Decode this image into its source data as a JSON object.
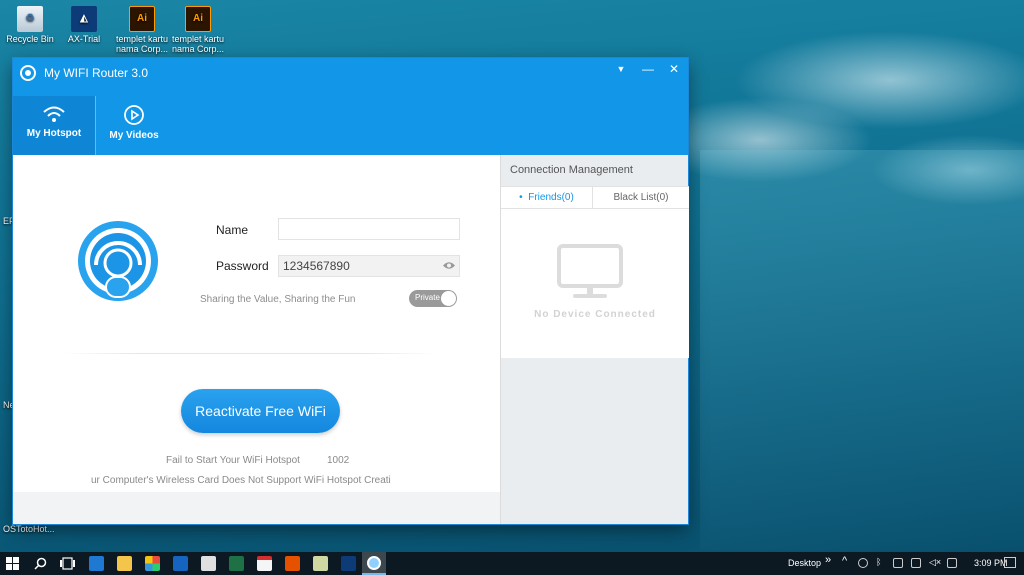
{
  "desktop": {
    "icons": [
      {
        "label": "Recycle Bin",
        "icon": "recycle-bin-icon"
      },
      {
        "label": "AX-Trial",
        "icon": "ax-trial-icon"
      },
      {
        "label": "templet kartu nama Corp...",
        "icon": "illustrator-file-icon"
      },
      {
        "label": "templet kartu nama Corp...",
        "icon": "illustrator-file-icon"
      }
    ],
    "edge_labels": {
      "ep": "EP",
      "ne": "Ne",
      "ostoto": "OSTotoHot..."
    }
  },
  "window": {
    "title": "My WIFI Router 3.0",
    "controls": {
      "menu": "▼",
      "minimize": "—",
      "close": "✕"
    },
    "tabs": [
      {
        "label": "My Hotspot",
        "icon": "wifi-icon",
        "active": true
      },
      {
        "label": "My Videos",
        "icon": "play-icon",
        "active": false
      }
    ]
  },
  "hotspot": {
    "name_label": "Name",
    "name_value": "",
    "password_label": "Password",
    "password_value": "1234567890",
    "slogan": "Sharing the Value, Sharing the Fun",
    "privacy_toggle": "Private",
    "reactivate_button": "Reactivate Free WiFi",
    "status_line": "Fail to Start Your WiFi Hotspot",
    "status_code": "1002",
    "error_detail": "ur Computer's Wireless Card Does Not Support WiFi Hotspot Creati"
  },
  "connection": {
    "title": "Connection Management",
    "tabs": [
      {
        "label": "Friends(0)",
        "active": true
      },
      {
        "label": "Black List(0)",
        "active": false
      }
    ],
    "empty_text": "No Device Connected"
  },
  "taskbar": {
    "desktop_label": "Desktop",
    "overflow": "»",
    "clock": "3:09 PM"
  },
  "colors": {
    "accent": "#1296e8",
    "title_bar": "#1296e8",
    "button": "#1a8fe3"
  }
}
